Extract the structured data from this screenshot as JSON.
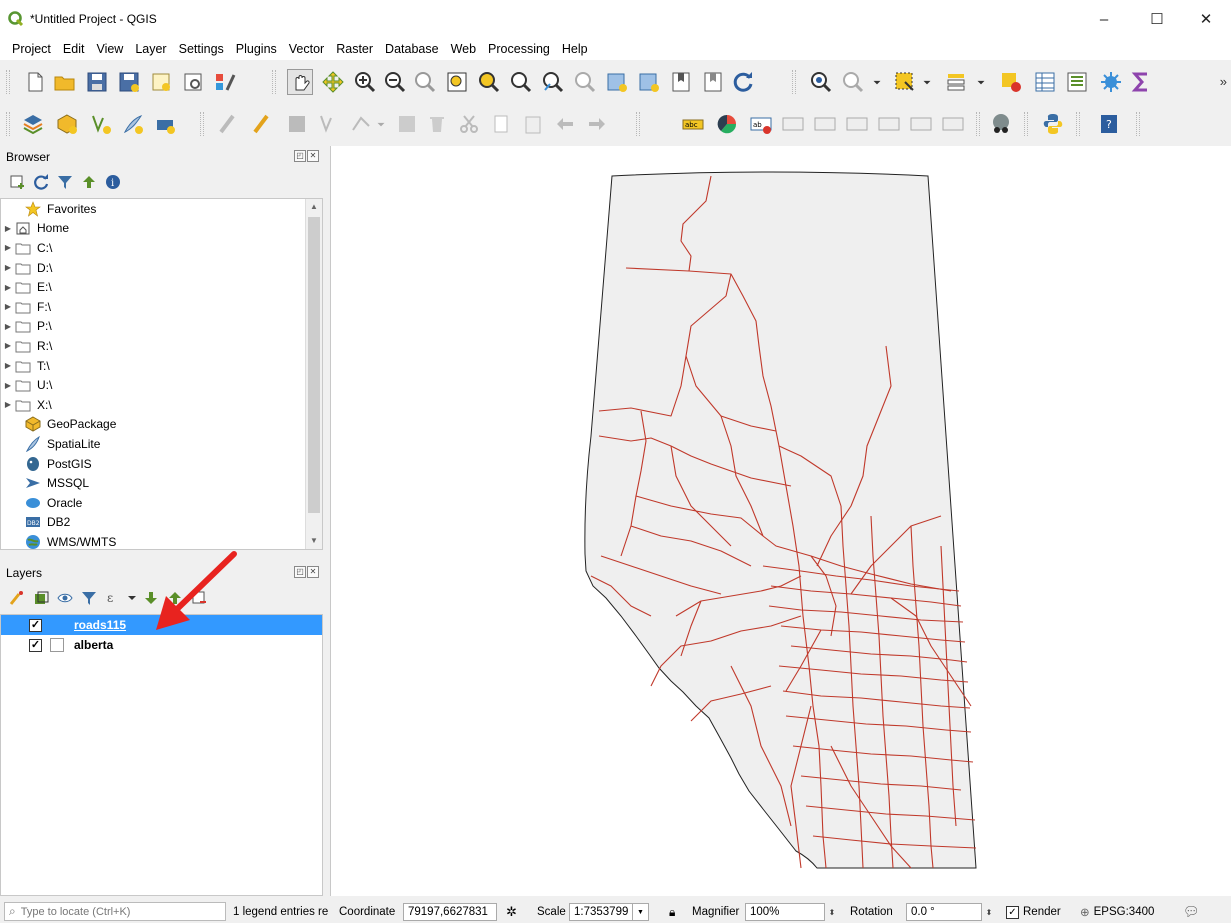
{
  "window": {
    "title": "*Untitled Project - QGIS",
    "minimize_glyph": "–",
    "maximize_glyph": "☐",
    "close_glyph": "✕"
  },
  "menu": [
    "Project",
    "Edit",
    "View",
    "Layer",
    "Settings",
    "Plugins",
    "Vector",
    "Raster",
    "Database",
    "Web",
    "Processing",
    "Help"
  ],
  "toolbar_more": "»",
  "browser": {
    "title": "Browser",
    "items": [
      {
        "label": "Favorites",
        "icon": "star-icon",
        "expandable": false
      },
      {
        "label": "Home",
        "icon": "home-folder-icon",
        "expandable": true
      },
      {
        "label": "C:\\",
        "icon": "folder-icon",
        "expandable": true
      },
      {
        "label": "D:\\",
        "icon": "folder-icon",
        "expandable": true
      },
      {
        "label": "E:\\",
        "icon": "folder-icon",
        "expandable": true
      },
      {
        "label": "F:\\",
        "icon": "folder-icon",
        "expandable": true
      },
      {
        "label": "P:\\",
        "icon": "folder-icon",
        "expandable": true
      },
      {
        "label": "R:\\",
        "icon": "folder-icon",
        "expandable": true
      },
      {
        "label": "T:\\",
        "icon": "folder-icon",
        "expandable": true
      },
      {
        "label": "U:\\",
        "icon": "folder-icon",
        "expandable": true
      },
      {
        "label": "X:\\",
        "icon": "folder-icon",
        "expandable": true
      },
      {
        "label": "GeoPackage",
        "icon": "geopackage-icon",
        "expandable": false
      },
      {
        "label": "SpatiaLite",
        "icon": "spatialite-icon",
        "expandable": false
      },
      {
        "label": "PostGIS",
        "icon": "postgis-icon",
        "expandable": false
      },
      {
        "label": "MSSQL",
        "icon": "mssql-icon",
        "expandable": false
      },
      {
        "label": "Oracle",
        "icon": "oracle-icon",
        "expandable": false
      },
      {
        "label": "DB2",
        "icon": "db2-icon",
        "expandable": false
      },
      {
        "label": "WMS/WMTS",
        "icon": "wms-icon",
        "expandable": false
      }
    ]
  },
  "layers": {
    "title": "Layers",
    "items": [
      {
        "name": "roads115",
        "checked": "✓",
        "selected": true
      },
      {
        "name": "alberta",
        "checked": "✓",
        "selected": false
      }
    ]
  },
  "status": {
    "locator_placeholder": "Type to locate (Ctrl+K)",
    "legend_msg": "1 legend entries re",
    "coordinate_label": "Coordinate",
    "coordinate_value": "79197,6627831",
    "scale_label": "Scale",
    "scale_value": "1:7353799",
    "magnifier_label": "Magnifier",
    "magnifier_value": "100%",
    "rotation_label": "Rotation",
    "rotation_value": "0.0 °",
    "render_label": "Render",
    "render_checked": "✓",
    "crs": "EPSG:3400"
  },
  "colors": {
    "road": "#c0392b",
    "province_fill": "#efefef",
    "selection": "#3399ff",
    "annotation_arrow": "#e8231f"
  }
}
